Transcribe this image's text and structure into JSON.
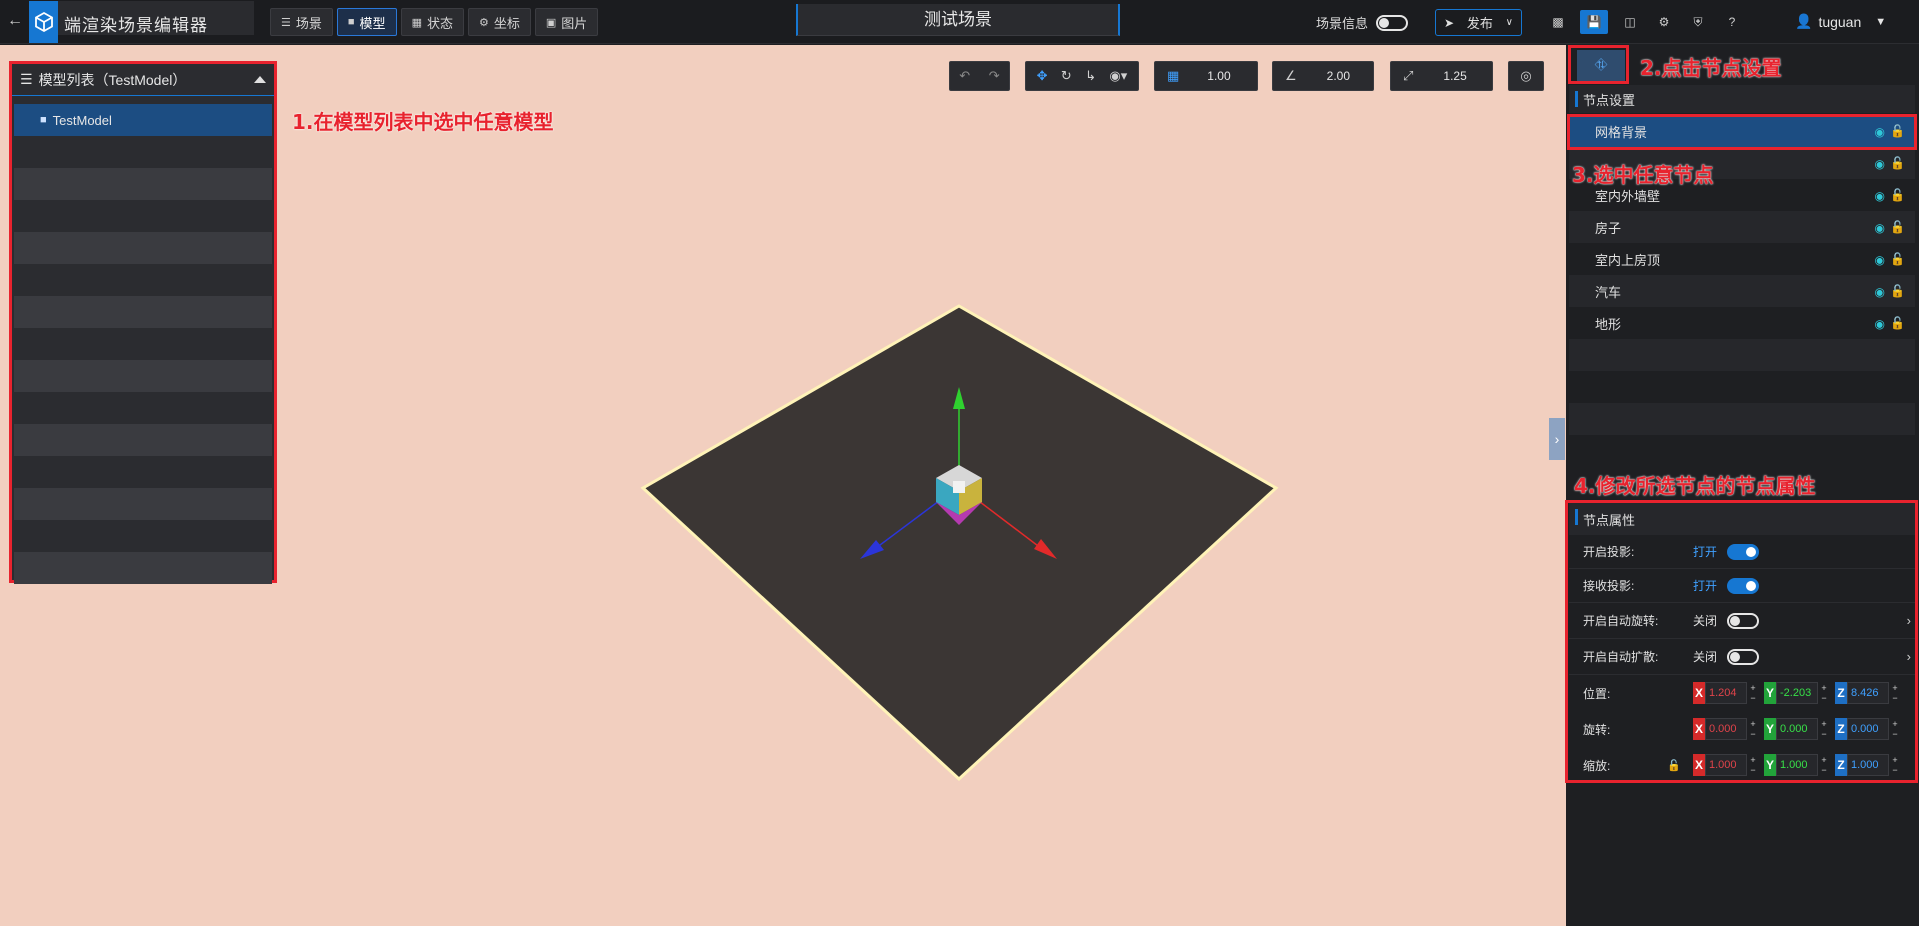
{
  "app": {
    "title": "端渲染场景编辑器",
    "scene_name": "测试场景"
  },
  "tabs": [
    {
      "label": "场景",
      "icon": "layers-icon"
    },
    {
      "label": "模型",
      "icon": "cube-icon"
    },
    {
      "label": "状态",
      "icon": "grid-icon"
    },
    {
      "label": "坐标",
      "icon": "coordinate-icon"
    },
    {
      "label": "图片",
      "icon": "image-icon"
    }
  ],
  "header": {
    "scene_info_label": "场景信息",
    "publish_label": "发布",
    "user_name": "tuguan"
  },
  "viewport": {
    "grid_value": "1.00",
    "angle_value": "2.00",
    "scale_value": "1.25"
  },
  "model_list": {
    "title": "模型列表（TestModel）",
    "items": [
      "TestModel"
    ]
  },
  "annotations": {
    "step1": "1.在模型列表中选中任意模型",
    "step2": "2.点击节点设置",
    "step3": "3.选中任意节点",
    "step4": "4.修改所选节点的节点属性"
  },
  "node_settings": {
    "title": "节点设置",
    "nodes": [
      "网格背景",
      "",
      "室内外墙壁",
      "房子",
      "室内上房顶",
      "汽车",
      "地形"
    ]
  },
  "node_properties": {
    "title": "节点属性",
    "cast_shadow": {
      "label": "开启投影:",
      "value": "打开"
    },
    "receive_shadow": {
      "label": "接收投影:",
      "value": "打开"
    },
    "auto_rotate": {
      "label": "开启自动旋转:",
      "value": "关闭"
    },
    "auto_spread": {
      "label": "开启自动扩散:",
      "value": "关闭"
    },
    "position": {
      "label": "位置:",
      "x": "1.204",
      "y": "-2.203",
      "z": "8.426"
    },
    "rotation": {
      "label": "旋转:",
      "x": "0.000",
      "y": "0.000",
      "z": "0.000"
    },
    "scale": {
      "label": "缩放:",
      "x": "1.000",
      "y": "1.000",
      "z": "1.000"
    }
  },
  "colors": {
    "accent": "#1677d2",
    "viewport_bg": "#f2cfbf",
    "annotation": "#e8232e",
    "axis_x": "#d52a2a",
    "axis_y": "#22a33a",
    "axis_z": "#1e6fc4"
  }
}
